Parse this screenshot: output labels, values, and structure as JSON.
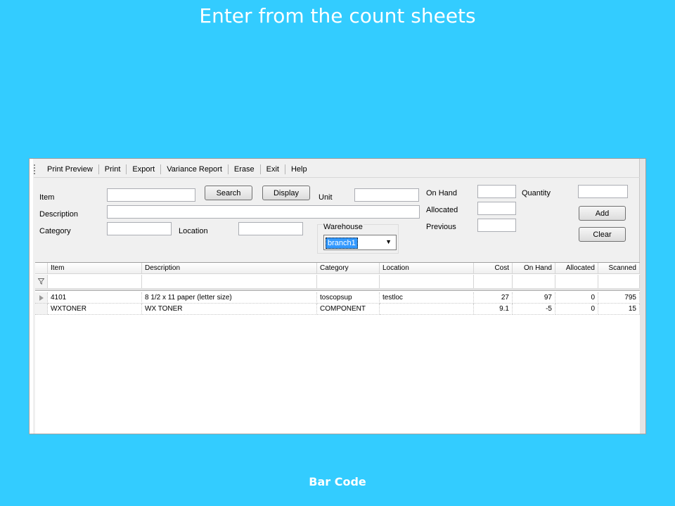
{
  "slide": {
    "title": "Enter from the count sheets",
    "caption": "Bar Code"
  },
  "menu": {
    "items": [
      "Print Preview",
      "Print",
      "Export",
      "Variance Report",
      "Erase",
      "Exit",
      "Help"
    ]
  },
  "form": {
    "item_label": "Item",
    "description_label": "Description",
    "category_label": "Category",
    "location_label": "Location",
    "unit_label": "Unit",
    "warehouse_label": "Warehouse",
    "warehouse_value": "branch1",
    "on_hand_label": "On Hand",
    "allocated_label": "Allocated",
    "previous_label": "Previous",
    "quantity_label": "Quantity",
    "search_label": "Search",
    "display_label": "Display",
    "add_label": "Add",
    "clear_label": "Clear"
  },
  "grid": {
    "columns": [
      "Item",
      "Description",
      "Category",
      "Location",
      "Cost",
      "On Hand",
      "Allocated",
      "Scanned"
    ],
    "rows": [
      [
        "4101",
        "8 1/2 x 11 paper (letter size)",
        "toscopsup",
        "testloc",
        "27",
        "97",
        "0",
        "795"
      ],
      [
        "WXTONER",
        "WX TONER",
        "COMPONENT",
        "",
        "9.1",
        "-5",
        "0",
        "15"
      ]
    ]
  },
  "icons": {
    "filter": "filter-icon",
    "row_pointer": "row-pointer-icon",
    "dropdown": "chevron-down-icon"
  }
}
